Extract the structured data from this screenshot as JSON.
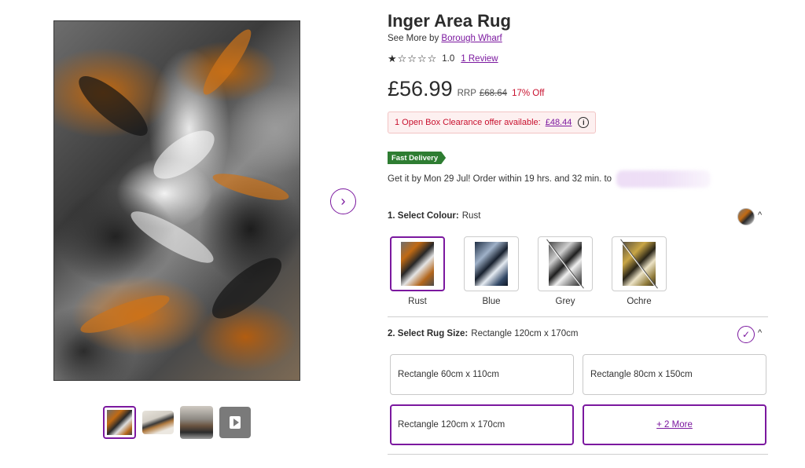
{
  "product": {
    "title": "Inger Area Rug",
    "see_more_prefix": "See More by",
    "brand": "Borough Wharf",
    "stars": "★☆☆☆☆",
    "rating": "1.0",
    "reviews_link": "1 Review"
  },
  "price": {
    "current": "£56.99",
    "rrp_label": "RRP",
    "rrp": "£68.64",
    "discount": "17% Off"
  },
  "clearance": {
    "text": "1 Open Box Clearance offer available:",
    "price": "£48.44",
    "icon": "info-icon"
  },
  "delivery": {
    "badge": "Fast Delivery",
    "text": "Get it by Mon 29 Jul! Order within 19 hrs. and 32 min. to"
  },
  "colour_section": {
    "label": "1. Select Colour:",
    "selected": "Rust",
    "options": [
      {
        "name": "Rust"
      },
      {
        "name": "Blue"
      },
      {
        "name": "Grey"
      },
      {
        "name": "Ochre"
      }
    ]
  },
  "size_section": {
    "label": "2. Select Rug Size:",
    "selected": "Rectangle 120cm x 170cm",
    "options": [
      "Rectangle 60cm x 110cm",
      "Rectangle 80cm x 150cm",
      "Rectangle 120cm x 170cm",
      "+ 2 More"
    ]
  },
  "icons": {
    "next": "chevron-right-icon",
    "collapse": "chevron-up-icon",
    "check": "check-icon",
    "play": "play-icon"
  },
  "colors": {
    "accent": "#7b189f",
    "sale": "#c8102e",
    "fast_delivery": "#2e7d32"
  }
}
